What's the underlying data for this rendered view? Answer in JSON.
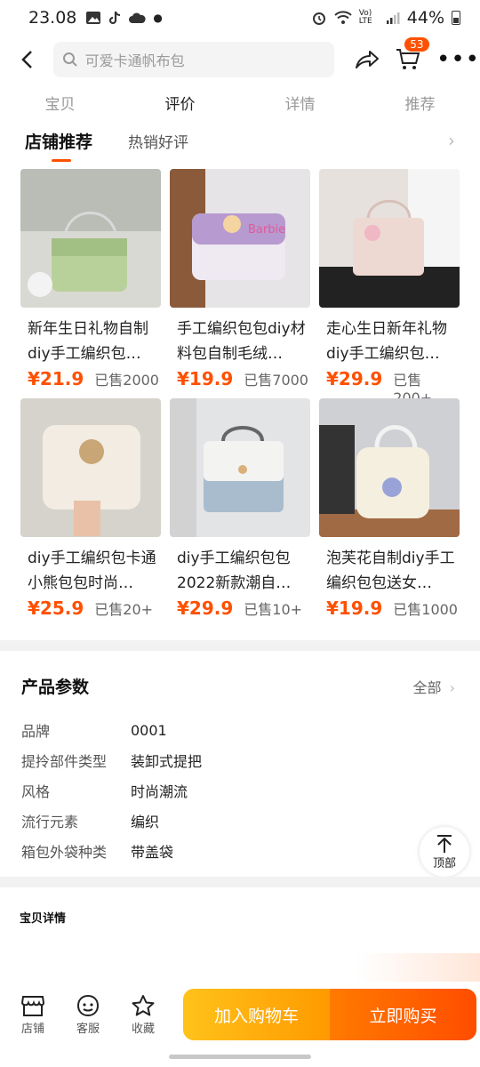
{
  "status_bar": {
    "time": "23.08",
    "battery": "44%",
    "network": "Vo) LTE"
  },
  "search": {
    "placeholder": "可爱卡通帆布包"
  },
  "cart": {
    "badge": "53"
  },
  "tabs": [
    "宝贝",
    "评价",
    "详情",
    "推荐"
  ],
  "store_rec": {
    "active_tab": "店铺推荐",
    "other_tab": "热销好评"
  },
  "products": [
    {
      "name": "新年生日礼物自制diy手工编织包…",
      "price": "¥21.9",
      "sold": "已售2000"
    },
    {
      "name": "手工编织包包diy材料包自制毛绒…",
      "price": "¥19.9",
      "sold": "已售7000"
    },
    {
      "name": "走心生日新年礼物diy手工编织包…",
      "price": "¥29.9",
      "sold": "已售200+"
    },
    {
      "name": "diy手工编织包卡通小熊包包时尚…",
      "price": "¥25.9",
      "sold": "已售20+"
    },
    {
      "name": "diy手工编织包包2022新款潮自…",
      "price": "¥29.9",
      "sold": "已售10+"
    },
    {
      "name": "泡芙花自制diy手工编织包包送女…",
      "price": "¥19.9",
      "sold": "已售1000"
    }
  ],
  "params": {
    "title": "产品参数",
    "all_label": "全部",
    "rows": [
      {
        "key": "品牌",
        "value": "0001"
      },
      {
        "key": "提拎部件类型",
        "value": "装卸式提把"
      },
      {
        "key": "风格",
        "value": "时尚潮流"
      },
      {
        "key": "流行元素",
        "value": "编织"
      },
      {
        "key": "箱包外袋种类",
        "value": "带盖袋"
      }
    ]
  },
  "top_button": "顶部",
  "detail_title": "宝贝详情",
  "bottom_bar": {
    "store": "店铺",
    "service": "客服",
    "favorite": "收藏",
    "add_to_cart": "加入购物车",
    "buy_now": "立即购买"
  },
  "colors": {
    "accent": "#ff5000",
    "price": "#ff5000"
  }
}
